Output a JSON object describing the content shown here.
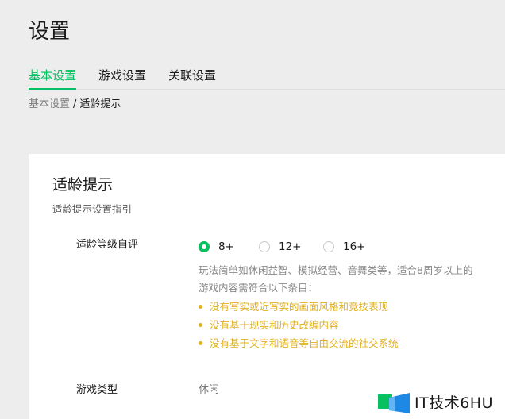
{
  "page": {
    "title": "设置"
  },
  "tabs": [
    {
      "label": "基本设置",
      "active": true
    },
    {
      "label": "游戏设置",
      "active": false
    },
    {
      "label": "关联设置",
      "active": false
    }
  ],
  "breadcrumb": {
    "parent": "基本设置",
    "separator": "/",
    "current": "适龄提示"
  },
  "card": {
    "title": "适龄提示",
    "subtitle": "适龄提示设置指引",
    "rating": {
      "label": "适龄等级自评",
      "options": [
        {
          "label": "8+",
          "checked": true
        },
        {
          "label": "12+",
          "checked": false
        },
        {
          "label": "16+",
          "checked": false
        }
      ],
      "description_line1": "玩法简单如休闲益智、模拟经营、音舞类等，适合8周岁以上的",
      "description_line2": "游戏内容需符合以下条目：",
      "rules": [
        "没有写实或近写实的画面风格和竞技表现",
        "没有基于现实和历史改编内容",
        "没有基于文字和语音等自由交流的社交系统"
      ]
    },
    "game_type": {
      "label": "游戏类型",
      "value": "休闲"
    }
  },
  "watermark": {
    "text": "IT技术6HU",
    "icon": "logo-icon"
  },
  "colors": {
    "accent": "#07c160",
    "warning": "#e0b020",
    "background": "#ededed",
    "card": "#ffffff"
  }
}
